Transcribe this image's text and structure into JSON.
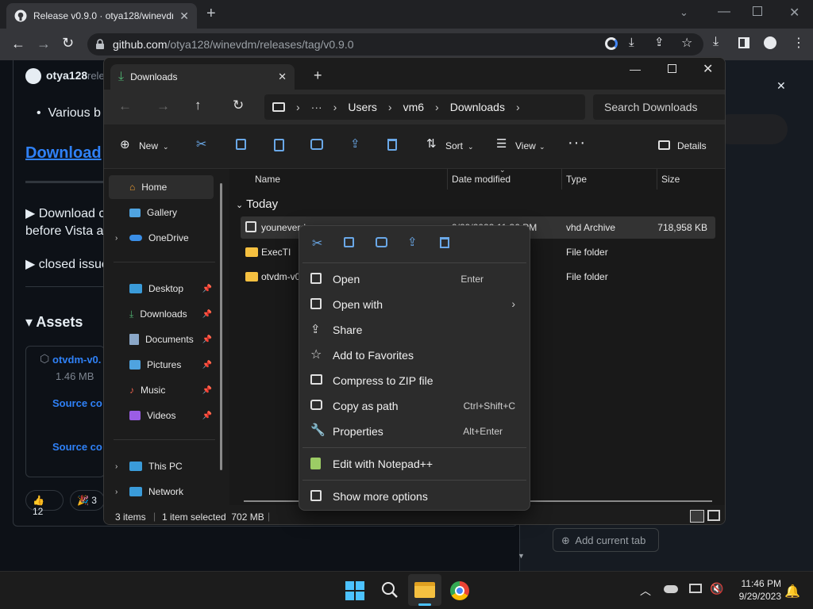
{
  "browser": {
    "tab_title": "Release v0.9.0 · otya128/winevdm",
    "url_host": "github.com",
    "url_path": "/otya128/winevdm/releases/tag/v0.9.0"
  },
  "github": {
    "author": "otya128",
    "author_tail": "rele",
    "bullet": "Various b",
    "download_link": "Download",
    "expander1": "Download c",
    "expander1_line2": "before Vista a",
    "expander2": "closed issue",
    "assets_heading": "Assets",
    "asset1": "otvdm-v0.",
    "asset1_size": "1.46 MB",
    "asset2": "Source co",
    "asset3": "Source co",
    "react1_count": "12",
    "react2_count": "3",
    "add_current_tab": "Add current tab"
  },
  "explorer": {
    "tab_title": "Downloads",
    "breadcrumb": [
      "Users",
      "vm6",
      "Downloads"
    ],
    "search_placeholder": "Search Downloads",
    "cmd": {
      "new": "New",
      "sort": "Sort",
      "view": "View",
      "details": "Details"
    },
    "nav": {
      "home": "Home",
      "gallery": "Gallery",
      "onedrive": "OneDrive",
      "desktop": "Desktop",
      "downloads": "Downloads",
      "documents": "Documents",
      "pictures": "Pictures",
      "music": "Music",
      "videos": "Videos",
      "thispc": "This PC",
      "network": "Network"
    },
    "columns": {
      "name": "Name",
      "date": "Date modified",
      "type": "Type",
      "size": "Size"
    },
    "group": "Today",
    "files": [
      {
        "name": "youneverd",
        "date": "9/29/2023 11:36 PM",
        "type": "vhd Archive",
        "size": "718,958 KB"
      },
      {
        "name": "ExecTI",
        "date": "",
        "type": "File folder",
        "size": ""
      },
      {
        "name": "otvdm-v0",
        "date": "",
        "type": "File folder",
        "size": ""
      }
    ],
    "status": {
      "items": "3 items",
      "selected": "1 item selected  702 MB"
    }
  },
  "context_menu": {
    "items": [
      {
        "label": "Open",
        "shortcut": "Enter"
      },
      {
        "label": "Open with",
        "shortcut": ""
      },
      {
        "label": "Share",
        "shortcut": ""
      },
      {
        "label": "Add to Favorites",
        "shortcut": ""
      },
      {
        "label": "Compress to ZIP file",
        "shortcut": ""
      },
      {
        "label": "Copy as path",
        "shortcut": "Ctrl+Shift+C"
      },
      {
        "label": "Properties",
        "shortcut": "Alt+Enter"
      },
      {
        "label": "Edit with Notepad++",
        "shortcut": ""
      },
      {
        "label": "Show more options",
        "shortcut": ""
      }
    ]
  },
  "taskbar": {
    "time": "11:46 PM",
    "date": "9/29/2023"
  }
}
